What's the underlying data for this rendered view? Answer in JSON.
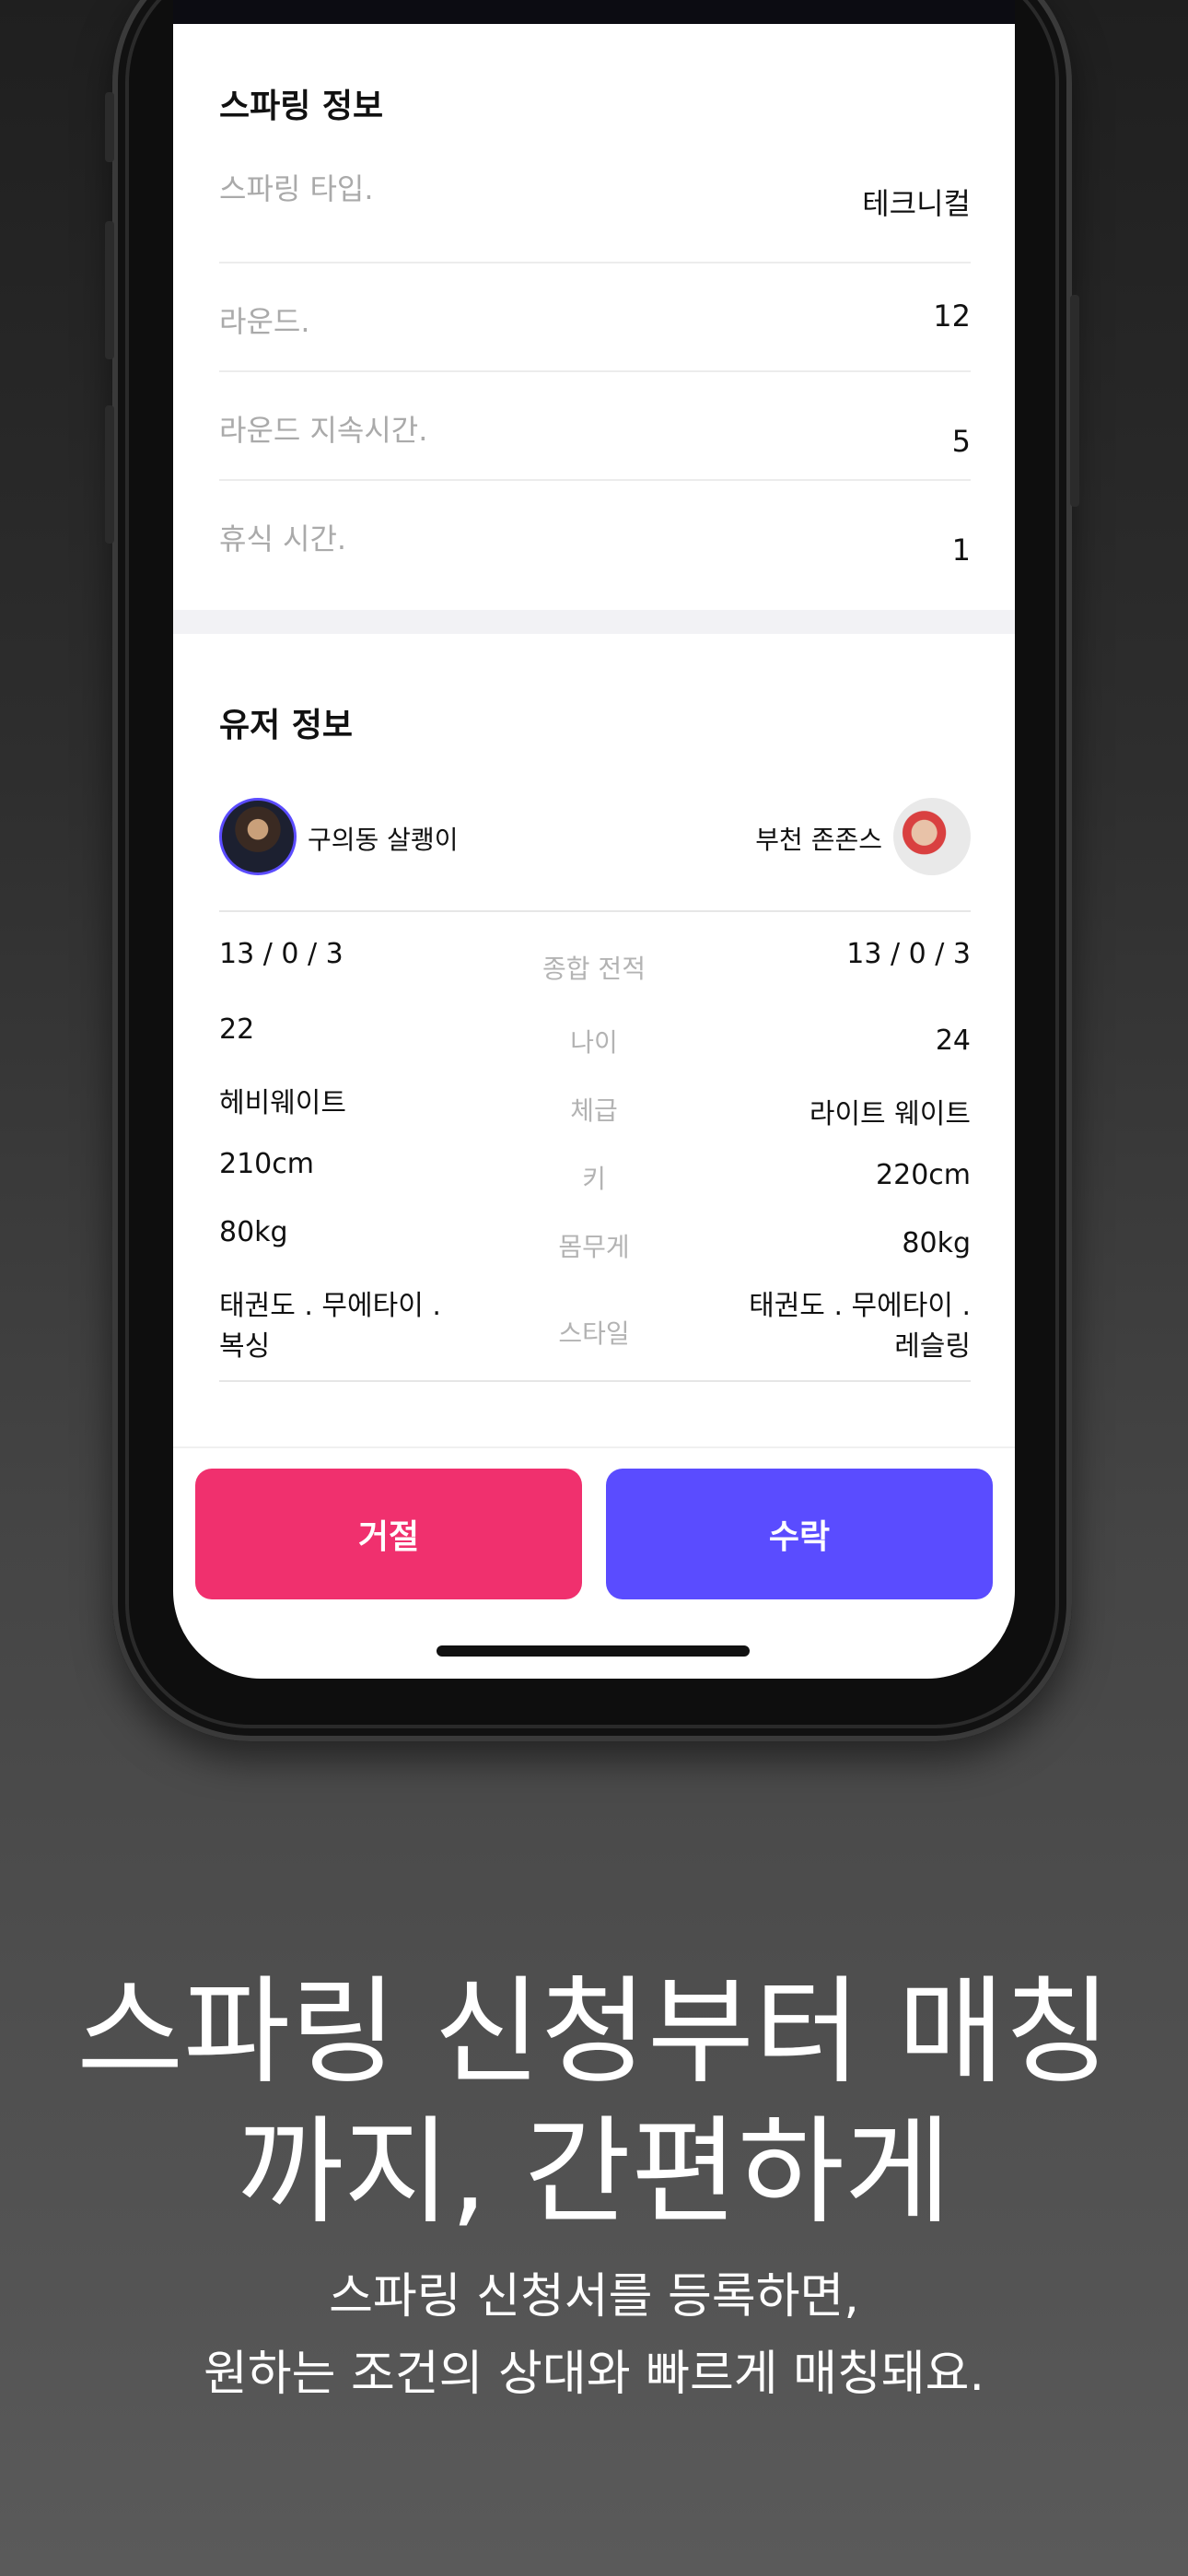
{
  "spar_info": {
    "title": "스파링 정보",
    "rows": [
      {
        "label": "스파링 타입.",
        "value": "테크니컬"
      },
      {
        "label": "라운드.",
        "value": "12"
      },
      {
        "label": "라운드 지속시간.",
        "value": "5"
      },
      {
        "label": "휴식 시간.",
        "value": "1"
      }
    ]
  },
  "user_info": {
    "title": "유저 정보",
    "left_user": "구의동 살쾡이",
    "right_user": "부천 존존스",
    "stats": {
      "record_left": "13 / 0 / 3",
      "record_label": "종합 전적",
      "record_right": "13 / 0 / 3",
      "age_left": "22",
      "age_label": "나이",
      "age_right": "24",
      "weight_class_left": "헤비웨이트",
      "weight_class_label": "체급",
      "weight_class_right": "라이트 웨이트",
      "height_left": "210cm",
      "height_label": "키",
      "height_right": "220cm",
      "weight_left": "80kg",
      "weight_label": "몸무게",
      "weight_right": "80kg",
      "style_left_1": "태권도 . 무에타이 .",
      "style_left_2": "복싱",
      "style_label": "스타일",
      "style_right_1": "태권도 . 무에타이 .",
      "style_right_2": "레슬링"
    }
  },
  "buttons": {
    "reject": "거절",
    "accept": "수락"
  },
  "promo": {
    "headline_1": "스파링 신청부터 매칭",
    "headline_2": "까지, 간편하게",
    "sub_1": "스파링 신청서를 등록하면,",
    "sub_2": "원하는 조건의 상대와 빠르게 매칭돼요."
  },
  "colors": {
    "reject": "#f0306e",
    "accept": "#5a4cff"
  }
}
